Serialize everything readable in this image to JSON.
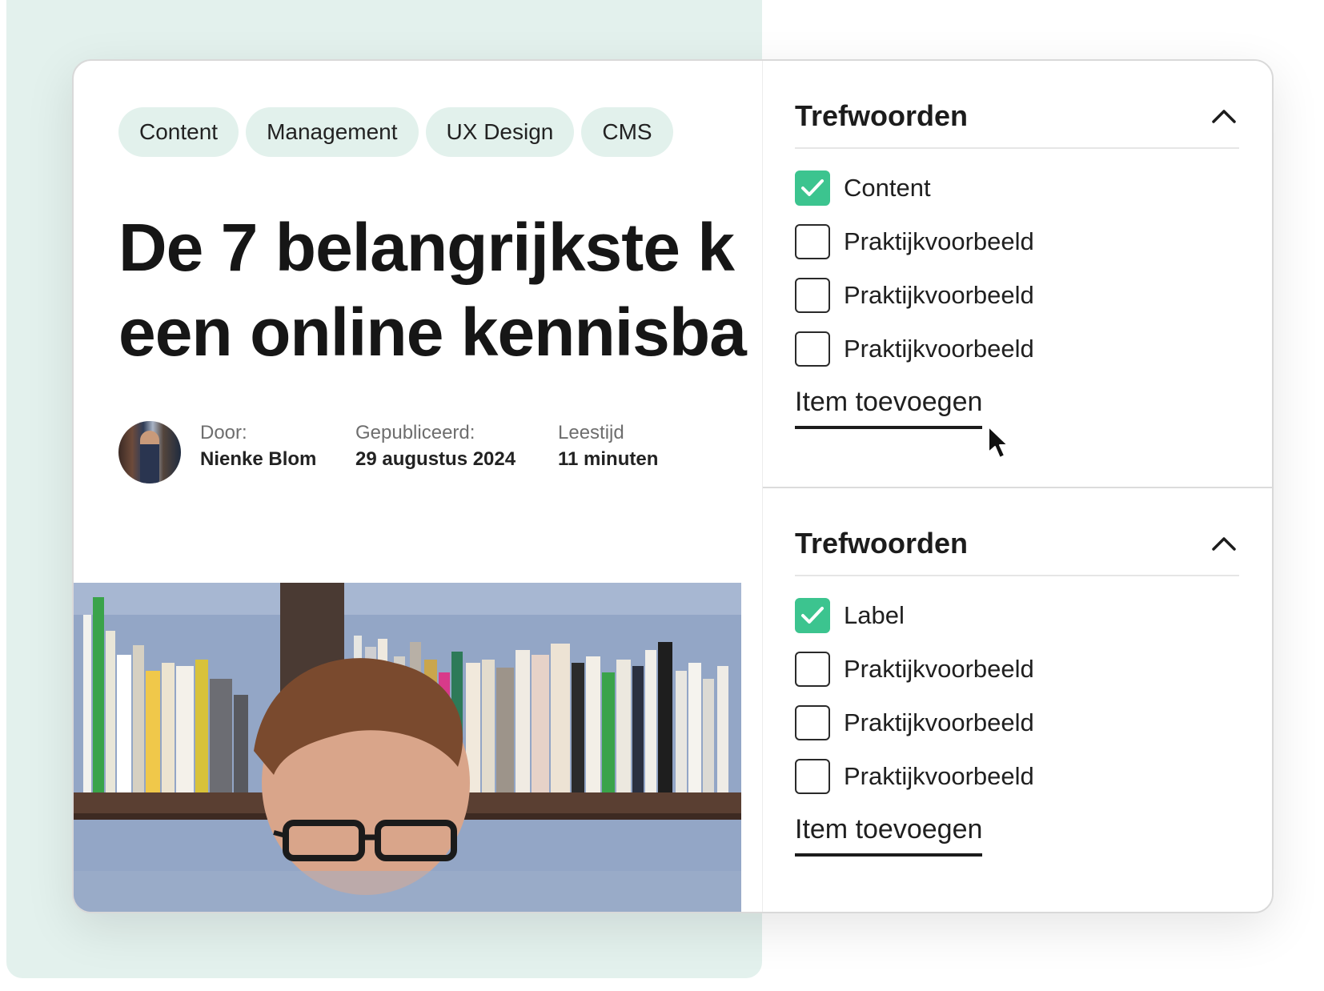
{
  "article": {
    "tags": [
      "Content",
      "Management",
      "UX Design",
      "CMS"
    ],
    "title_line1": "De 7 belangrijkste k",
    "title_line2": "een online kennisba",
    "author_label": "Door:",
    "author_name": "Nienke Blom",
    "published_label": "Gepubliceerd:",
    "published_date": "29 augustus 2024",
    "readtime_label": "Leestijd",
    "readtime_value": "11 minuten"
  },
  "filters": [
    {
      "title": "Trefwoorden",
      "expanded": true,
      "options": [
        {
          "label": "Content",
          "checked": true
        },
        {
          "label": "Praktijkvoorbeeld",
          "checked": false
        },
        {
          "label": "Praktijkvoorbeeld",
          "checked": false
        },
        {
          "label": "Praktijkvoorbeeld",
          "checked": false
        }
      ],
      "add_label": "Item toevoegen"
    },
    {
      "title": "Trefwoorden",
      "expanded": true,
      "options": [
        {
          "label": "Label",
          "checked": true
        },
        {
          "label": "Praktijkvoorbeeld",
          "checked": false
        },
        {
          "label": "Praktijkvoorbeeld",
          "checked": false
        },
        {
          "label": "Praktijkvoorbeeld",
          "checked": false
        }
      ],
      "add_label": "Item toevoegen"
    }
  ],
  "colors": {
    "accent_green": "#3cc48f",
    "tag_background": "#e2f1ec",
    "backdrop_mint": "#e3f1ed"
  }
}
